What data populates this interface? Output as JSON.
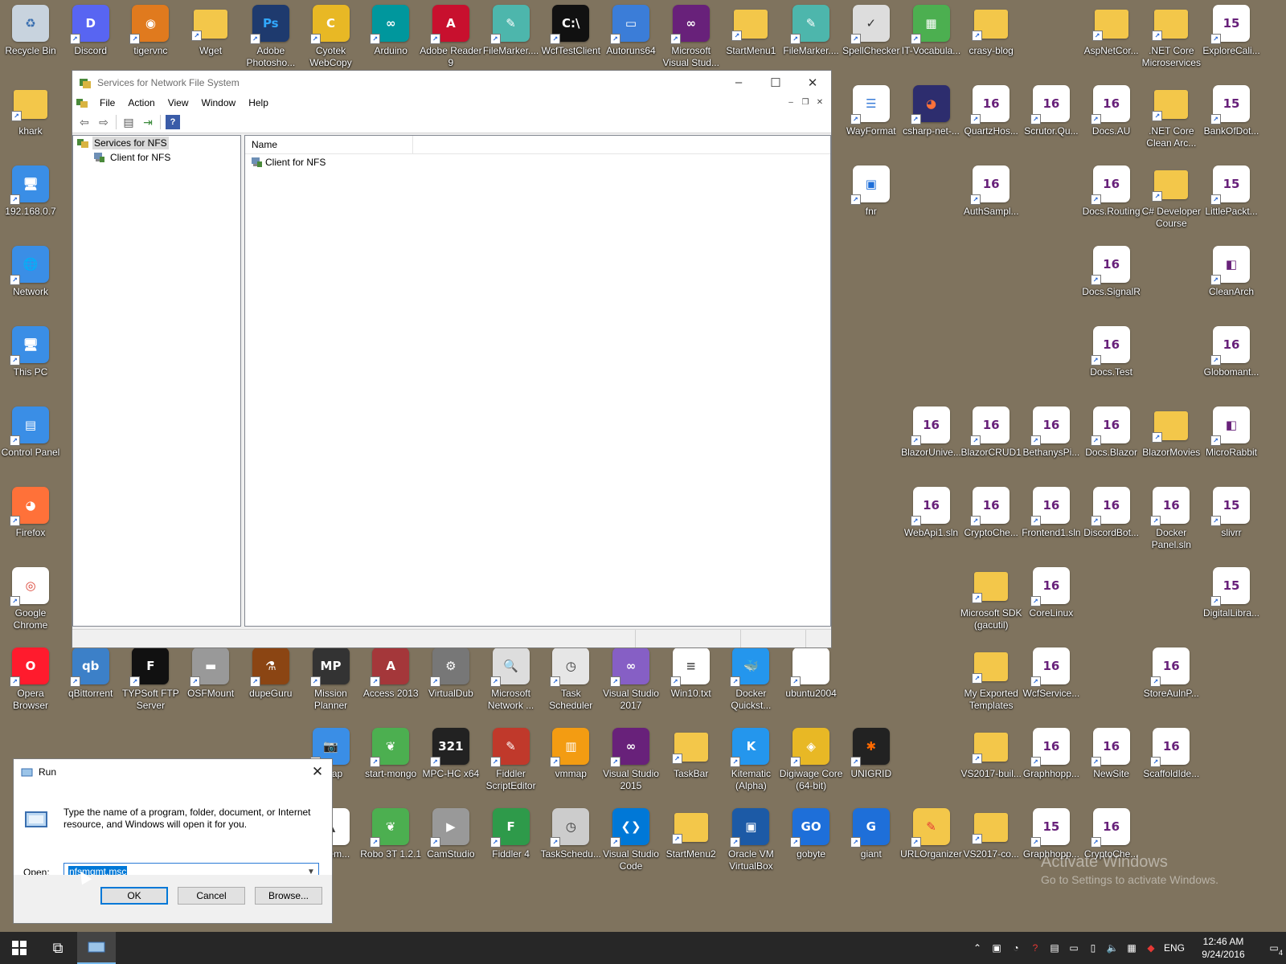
{
  "desktop": {
    "icons": [
      {
        "label": "Recycle Bin",
        "glyph": "♻",
        "color": "#c8d3de",
        "fg": "#3a6fb0"
      },
      {
        "label": "Discord",
        "glyph": "D",
        "color": "#5865f2",
        "fg": "#fff"
      },
      {
        "label": "tigervnc",
        "glyph": "◉",
        "color": "#e07a1e",
        "fg": "#fff"
      },
      {
        "label": "Wget",
        "glyph": "",
        "color": "#f3c74a",
        "fg": "#fff",
        "folder": true
      },
      {
        "label": "Adobe Photosho...",
        "glyph": "Ps",
        "color": "#1e3a6e",
        "fg": "#31a8ff"
      },
      {
        "label": "Cyotek WebCopy",
        "glyph": "C",
        "color": "#e8b825",
        "fg": "#fff"
      },
      {
        "label": "Arduino",
        "glyph": "∞",
        "color": "#00979d",
        "fg": "#fff"
      },
      {
        "label": "Adobe Reader 9",
        "glyph": "A",
        "color": "#c8102e",
        "fg": "#fff"
      },
      {
        "label": "FileMarker....",
        "glyph": "✎",
        "color": "#4db6ac",
        "fg": "#fff"
      },
      {
        "label": "WcfTestClient",
        "glyph": "C:\\",
        "color": "#111",
        "fg": "#fff"
      },
      {
        "label": "Autoruns64",
        "glyph": "▭",
        "color": "#3b7dd8",
        "fg": "#fff"
      },
      {
        "label": "Microsoft Visual Stud...",
        "glyph": "∞",
        "color": "#68217a",
        "fg": "#fff"
      },
      {
        "label": "StartMenu1",
        "glyph": "",
        "color": "#f3c74a",
        "fg": "#fff",
        "folder": true
      },
      {
        "label": "FileMarker....",
        "glyph": "✎",
        "color": "#4db6ac",
        "fg": "#fff"
      },
      {
        "label": "SpellChecker",
        "glyph": "✓",
        "color": "#ddd",
        "fg": "#333"
      },
      {
        "label": "IT-Vocabula...",
        "glyph": "▦",
        "color": "#4caf50",
        "fg": "#fff"
      },
      {
        "label": "crasy-blog",
        "glyph": "",
        "color": "#f3c74a",
        "fg": "#fff",
        "folder": true
      },
      {
        "label": "AspNetCor...",
        "glyph": "",
        "color": "#f3c74a",
        "fg": "#fff",
        "folder": true
      },
      {
        "label": ".NET Core Microservices",
        "glyph": "",
        "color": "#f3c74a",
        "fg": "#fff",
        "folder": true
      },
      {
        "label": "ExploreCali...",
        "glyph": "15",
        "color": "#fff",
        "fg": "#68217a"
      },
      {
        "label": "khark",
        "glyph": "",
        "color": "#f3c74a",
        "fg": "#fff",
        "folder": true
      },
      {
        "label": "WayFormat",
        "glyph": "☰",
        "color": "#fff",
        "fg": "#3b7dd8"
      },
      {
        "label": "csharp-net-...",
        "glyph": "◕",
        "color": "#2d2d6e",
        "fg": "#ff7139"
      },
      {
        "label": "QuartzHos...",
        "glyph": "16",
        "color": "#fff",
        "fg": "#68217a"
      },
      {
        "label": "Scrutor.Qu...",
        "glyph": "16",
        "color": "#fff",
        "fg": "#68217a"
      },
      {
        "label": "Docs.AU",
        "glyph": "16",
        "color": "#fff",
        "fg": "#68217a"
      },
      {
        "label": ".NET Core Clean Arc...",
        "glyph": "",
        "color": "#f3c74a",
        "fg": "#fff",
        "folder": true
      },
      {
        "label": "BankOfDot...",
        "glyph": "15",
        "color": "#fff",
        "fg": "#68217a"
      },
      {
        "label": "192.168.0.7",
        "glyph": "🖥",
        "color": "#3a8ee6",
        "fg": "#fff"
      },
      {
        "label": "fnr",
        "glyph": "▣",
        "color": "#fff",
        "fg": "#1e6fd9"
      },
      {
        "label": "AuthSampl...",
        "glyph": "16",
        "color": "#fff",
        "fg": "#68217a"
      },
      {
        "label": "Docs.Routing",
        "glyph": "16",
        "color": "#fff",
        "fg": "#68217a"
      },
      {
        "label": "C# Developer Course",
        "glyph": "",
        "color": "#f3c74a",
        "fg": "#fff",
        "folder": true
      },
      {
        "label": "LittlePackt...",
        "glyph": "15",
        "color": "#fff",
        "fg": "#68217a"
      },
      {
        "label": "Network",
        "glyph": "🌐",
        "color": "#3a8ee6",
        "fg": "#fff"
      },
      {
        "label": "Docs.SignalR",
        "glyph": "16",
        "color": "#fff",
        "fg": "#68217a"
      },
      {
        "label": "CleanArch",
        "glyph": "◧",
        "color": "#fff",
        "fg": "#68217a"
      },
      {
        "label": "This PC",
        "glyph": "🖥",
        "color": "#3a8ee6",
        "fg": "#fff"
      },
      {
        "label": "Docs.Test",
        "glyph": "16",
        "color": "#fff",
        "fg": "#68217a"
      },
      {
        "label": "Globomant...",
        "glyph": "16",
        "color": "#fff",
        "fg": "#68217a"
      },
      {
        "label": "Control Panel",
        "glyph": "▤",
        "color": "#3a8ee6",
        "fg": "#fff"
      },
      {
        "label": "BlazorUnive...",
        "glyph": "16",
        "color": "#fff",
        "fg": "#68217a"
      },
      {
        "label": "BlazorCRUD1",
        "glyph": "16",
        "color": "#fff",
        "fg": "#68217a"
      },
      {
        "label": "BethanysPi...",
        "glyph": "16",
        "color": "#fff",
        "fg": "#68217a"
      },
      {
        "label": "Docs.Blazor",
        "glyph": "16",
        "color": "#fff",
        "fg": "#68217a"
      },
      {
        "label": "BlazorMovies",
        "glyph": "",
        "color": "#f3c74a",
        "fg": "#fff",
        "folder": true
      },
      {
        "label": "MicroRabbit",
        "glyph": "◧",
        "color": "#fff",
        "fg": "#68217a"
      },
      {
        "label": "Firefox",
        "glyph": "◕",
        "color": "#ff7139",
        "fg": "#fff"
      },
      {
        "label": "WebApi1.sln",
        "glyph": "16",
        "color": "#fff",
        "fg": "#68217a"
      },
      {
        "label": "CryptoChe...",
        "glyph": "16",
        "color": "#fff",
        "fg": "#68217a"
      },
      {
        "label": "Frontend1.sln",
        "glyph": "16",
        "color": "#fff",
        "fg": "#68217a"
      },
      {
        "label": "DiscordBot...",
        "glyph": "16",
        "color": "#fff",
        "fg": "#68217a"
      },
      {
        "label": "Docker Panel.sln",
        "glyph": "16",
        "color": "#fff",
        "fg": "#68217a"
      },
      {
        "label": "slivrr",
        "glyph": "15",
        "color": "#fff",
        "fg": "#68217a"
      },
      {
        "label": "Google Chrome",
        "glyph": "◎",
        "color": "#fff",
        "fg": "#db4437"
      },
      {
        "label": "Microsoft SDK (gacutil)",
        "glyph": "",
        "color": "#f3c74a",
        "fg": "#fff",
        "folder": true
      },
      {
        "label": "CoreLinux",
        "glyph": "16",
        "color": "#fff",
        "fg": "#68217a"
      },
      {
        "label": "DigitalLibra...",
        "glyph": "15",
        "color": "#fff",
        "fg": "#68217a"
      },
      {
        "label": "Opera Browser",
        "glyph": "O",
        "color": "#ff1b2d",
        "fg": "#fff"
      },
      {
        "label": "qBittorrent",
        "glyph": "qb",
        "color": "#3c80c8",
        "fg": "#fff"
      },
      {
        "label": "TYPSoft FTP Server",
        "glyph": "F",
        "color": "#111",
        "fg": "#fff"
      },
      {
        "label": "OSFMount",
        "glyph": "▬",
        "color": "#999",
        "fg": "#fff"
      },
      {
        "label": "dupeGuru",
        "glyph": "⚗",
        "color": "#8b4513",
        "fg": "#fff"
      },
      {
        "label": "Mission Planner",
        "glyph": "MP",
        "color": "#333",
        "fg": "#fff"
      },
      {
        "label": "Access 2013",
        "glyph": "A",
        "color": "#a4373a",
        "fg": "#fff"
      },
      {
        "label": "VirtualDub",
        "glyph": "⚙",
        "color": "#777",
        "fg": "#fff"
      },
      {
        "label": "Microsoft Network ...",
        "glyph": "🔍",
        "color": "#ddd",
        "fg": "#333"
      },
      {
        "label": "Task Scheduler",
        "glyph": "◷",
        "color": "#e6e6e6",
        "fg": "#333"
      },
      {
        "label": "Visual Studio 2017",
        "glyph": "∞",
        "color": "#865fc5",
        "fg": "#fff"
      },
      {
        "label": "Win10.txt",
        "glyph": "≡",
        "color": "#fff",
        "fg": "#555"
      },
      {
        "label": "Docker Quickst...",
        "glyph": "🐳",
        "color": "#2496ed",
        "fg": "#fff"
      },
      {
        "label": "ubuntu2004",
        "glyph": "",
        "color": "#fff",
        "fg": "#555"
      },
      {
        "label": "My Exported Templates",
        "glyph": "",
        "color": "#f3c74a",
        "fg": "#fff",
        "folder": true
      },
      {
        "label": "WcfService...",
        "glyph": "16",
        "color": "#fff",
        "fg": "#68217a"
      },
      {
        "label": "StoreAulnP...",
        "glyph": "16",
        "color": "#fff",
        "fg": "#68217a"
      },
      {
        "label": "...cap",
        "glyph": "📷",
        "color": "#3a8ee6",
        "fg": "#fff"
      },
      {
        "label": "start-mongo",
        "glyph": "❦",
        "color": "#4caf50",
        "fg": "#fff"
      },
      {
        "label": "MPC-HC x64",
        "glyph": "321",
        "color": "#222",
        "fg": "#fff"
      },
      {
        "label": "Fiddler ScriptEditor",
        "glyph": "✎",
        "color": "#c0392b",
        "fg": "#fff"
      },
      {
        "label": "vmmap",
        "glyph": "▥",
        "color": "#f39c12",
        "fg": "#fff"
      },
      {
        "label": "Visual Studio 2015",
        "glyph": "∞",
        "color": "#68217a",
        "fg": "#fff"
      },
      {
        "label": "TaskBar",
        "glyph": "",
        "color": "#f3c74a",
        "fg": "#fff",
        "folder": true
      },
      {
        "label": "Kitematic (Alpha)",
        "glyph": "K",
        "color": "#2496ed",
        "fg": "#fff"
      },
      {
        "label": "Digiwage Core (64-bit)",
        "glyph": "◈",
        "color": "#e8b825",
        "fg": "#fff"
      },
      {
        "label": "UNIGRID",
        "glyph": "✱",
        "color": "#222",
        "fg": "#ff6a00"
      },
      {
        "label": "VS2017-buil...",
        "glyph": "",
        "color": "#f3c74a",
        "fg": "#fff",
        "folder": true
      },
      {
        "label": "Graphhopp...",
        "glyph": "16",
        "color": "#fff",
        "fg": "#68217a"
      },
      {
        "label": "NewSite",
        "glyph": "16",
        "color": "#fff",
        "fg": "#68217a"
      },
      {
        "label": "ScaffoldIde...",
        "glyph": "16",
        "color": "#fff",
        "fg": "#68217a"
      },
      {
        "label": "...urem...",
        "glyph": "▲",
        "color": "#fff",
        "fg": "#333"
      },
      {
        "label": "Robo 3T 1.2.1",
        "glyph": "❦",
        "color": "#4caf50",
        "fg": "#fff"
      },
      {
        "label": "CamStudio",
        "glyph": "▶",
        "color": "#999",
        "fg": "#fff"
      },
      {
        "label": "Fiddler 4",
        "glyph": "F",
        "color": "#2e9a4a",
        "fg": "#fff"
      },
      {
        "label": "TaskSchedu...",
        "glyph": "◷",
        "color": "#ccc",
        "fg": "#333"
      },
      {
        "label": "Visual Studio Code",
        "glyph": "❮❯",
        "color": "#0078d7",
        "fg": "#fff"
      },
      {
        "label": "StartMenu2",
        "glyph": "",
        "color": "#f3c74a",
        "fg": "#fff",
        "folder": true
      },
      {
        "label": "Oracle VM VirtualBox",
        "glyph": "▣",
        "color": "#1c5aa6",
        "fg": "#fff"
      },
      {
        "label": "gobyte",
        "glyph": "GO",
        "color": "#1e6fd9",
        "fg": "#fff"
      },
      {
        "label": "giant",
        "glyph": "G",
        "color": "#1e6fd9",
        "fg": "#fff"
      },
      {
        "label": "URLOrganizer",
        "glyph": "✎",
        "color": "#f3c74a",
        "fg": "#e53935"
      },
      {
        "label": "VS2017-co...",
        "glyph": "",
        "color": "#f3c74a",
        "fg": "#fff",
        "folder": true
      },
      {
        "label": "Graphhopp...",
        "glyph": "15",
        "color": "#fff",
        "fg": "#68217a"
      },
      {
        "label": "CryptoChe...",
        "glyph": "16",
        "color": "#fff",
        "fg": "#68217a"
      }
    ]
  },
  "mmc": {
    "title": "Services for Network File System",
    "menu": [
      "File",
      "Action",
      "View",
      "Window",
      "Help"
    ],
    "tree": {
      "root": "Services for NFS",
      "child": "Client for NFS"
    },
    "column_name": "Name",
    "rows": [
      "Client for NFS"
    ]
  },
  "run": {
    "title": "Run",
    "description": "Type the name of a program, folder, document, or Internet resource, and Windows will open it for you.",
    "open_label": "Open:",
    "open_value": "nfsmgmt.msc",
    "ok": "OK",
    "cancel": "Cancel",
    "browse": "Browse..."
  },
  "watermark": {
    "title": "Activate Windows",
    "subtitle": "Go to Settings to activate Windows."
  },
  "taskbar": {
    "lang": "ENG",
    "time": "12:46 AM",
    "date": "9/24/2016",
    "notifications": "4"
  }
}
